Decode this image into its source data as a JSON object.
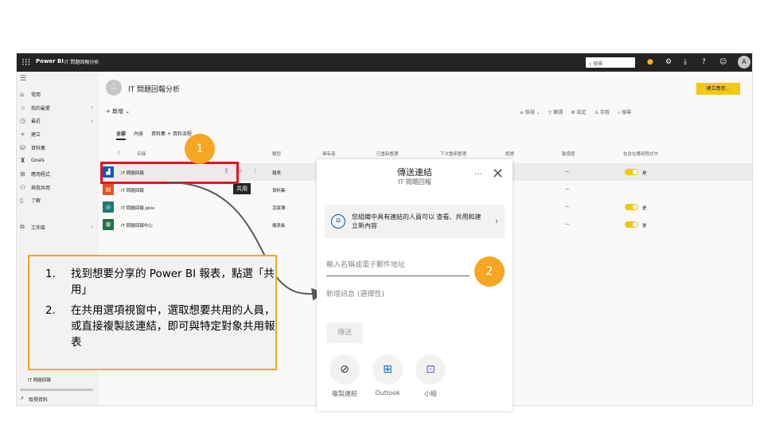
{
  "topbar": {
    "waffle": "⁝⁝⁝",
    "brand": "Power BI",
    "crumb": "IT 問題回報分析",
    "search_label": "⌕ 搜尋",
    "icons": [
      "bell-icon",
      "gear-icon",
      "download-icon",
      "help-icon",
      "smiley-icon"
    ],
    "avatar": "A"
  },
  "sidebar": {
    "items": [
      {
        "icon": "⌂",
        "label": "常用",
        "chevron": ""
      },
      {
        "icon": "☆",
        "label": "我的最愛",
        "chevron": "›"
      },
      {
        "icon": "◷",
        "label": "最近",
        "chevron": "›"
      },
      {
        "icon": "+",
        "label": "建立",
        "chevron": ""
      },
      {
        "icon": "⛁",
        "label": "資料集",
        "chevron": ""
      },
      {
        "icon": "♜",
        "label": "Goals",
        "chevron": ""
      },
      {
        "icon": "⊞",
        "label": "應用程式",
        "chevron": ""
      },
      {
        "icon": "⚇",
        "label": "與我共用",
        "chevron": ""
      },
      {
        "icon": "▯",
        "label": "了解",
        "chevron": ""
      },
      {
        "icon": "",
        "label": "",
        "chevron": ""
      },
      {
        "icon": "⧉",
        "label": "工作區",
        "chevron": "›"
      }
    ],
    "recent_workspace": "IT 問題回報",
    "get_data": "取得資料"
  },
  "workspace": {
    "title": "IT 問題回報分析",
    "create_app": "建立應用...",
    "new_label": "+ 新增 ⌄",
    "toolbar": [
      "≡ 檢視 ⌄",
      "▽ 篩選",
      "⚙ 設定",
      "♙ 存取",
      "⌕ 搜尋"
    ],
    "tabs": [
      "全部",
      "內容",
      "資料集 + 資料流程"
    ]
  },
  "list": {
    "headers": [
      "名稱",
      "類型",
      "擁有者",
      "已重新整理",
      "下次重新整理",
      "認證",
      "敏感度",
      "包含在應用程式中"
    ],
    "rows": [
      {
        "name": "IT 問題回報",
        "type": "報表",
        "icon_text": "▟",
        "icon_color": "#0f5bb5",
        "sens": "—",
        "toggle": true,
        "tlabel": "是"
      },
      {
        "name": "IT 問題回報",
        "type": "資料集",
        "icon_text": "▤",
        "icon_color": "#e3541c",
        "sens": "—",
        "toggle": false,
        "tlabel": ""
      },
      {
        "name": "IT 問題回報.pbix",
        "type": "活頁簿",
        "icon_text": "◎",
        "icon_color": "#1b7a74",
        "sens": "—",
        "toggle": true,
        "tlabel": "是"
      },
      {
        "name": "IT 問題回報中心",
        "type": "儀表板",
        "icon_text": "⊞",
        "icon_color": "#217346",
        "sens": "—",
        "toggle": true,
        "tlabel": "是"
      }
    ],
    "tooltip": "共用"
  },
  "share_panel": {
    "title": "傳送連結",
    "subtitle": "IT 問題回報",
    "org_text": "您組織中具有連結的人員可以 查看、共用和建立新內容",
    "email_placeholder": "輸入名稱或電子郵件地址",
    "message_placeholder": "新增訊息 (選擇性)",
    "send": "傳送",
    "options": [
      {
        "label": "複製連結",
        "icon": "copy-link-icon",
        "glyph": "⊘"
      },
      {
        "label": "Outlook",
        "icon": "outlook-icon",
        "glyph": "⊞"
      },
      {
        "label": "小組",
        "icon": "teams-icon",
        "glyph": "⊡"
      }
    ]
  },
  "markers": [
    "1",
    "2"
  ],
  "callout": {
    "steps": [
      {
        "num": "1.",
        "text": "找到想要分享的 Power BI 報表，點選「共用」"
      },
      {
        "num": "2.",
        "text": "在共用選項視窗中，選取想要共用的人員，或直接複製該連結，即可與特定對象共用報表"
      }
    ]
  },
  "colors": {
    "accent": "#f5a623",
    "highlight": "#e81123",
    "brand": "#f2c811",
    "topbar": "#252423"
  }
}
